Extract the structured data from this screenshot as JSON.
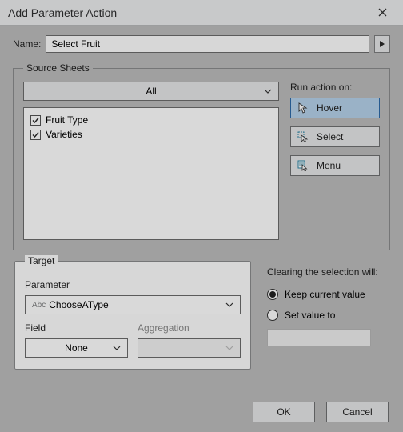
{
  "title": "Add Parameter Action",
  "name_label": "Name:",
  "name_value": "Select Fruit",
  "source_sheets": {
    "legend": "Source Sheets",
    "dropdown_value": "All",
    "items": [
      "Fruit Type",
      "Varieties"
    ],
    "run_label": "Run action on:",
    "actions": {
      "hover": "Hover",
      "select": "Select",
      "menu": "Menu"
    }
  },
  "target": {
    "legend": "Target",
    "parameter_label": "Parameter",
    "parameter_icon": "Abc",
    "parameter_value": "ChooseAType",
    "field_label": "Field",
    "field_value": "None",
    "aggregation_label": "Aggregation",
    "aggregation_value": ""
  },
  "clearing": {
    "title": "Clearing the selection will:",
    "keep": "Keep current value",
    "setto": "Set value to"
  },
  "buttons": {
    "ok": "OK",
    "cancel": "Cancel"
  }
}
